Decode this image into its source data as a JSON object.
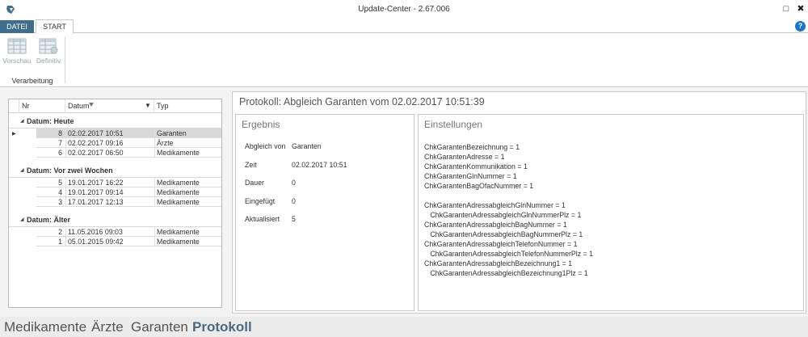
{
  "window": {
    "title": "Update-Center - 2.67.006",
    "maximize_glyph": "□",
    "close_glyph": "✖"
  },
  "ribbon": {
    "tabs": [
      {
        "label": "DATEI"
      },
      {
        "label": "START"
      }
    ],
    "help_glyph": "?",
    "buttons": [
      {
        "label": "Vorschau",
        "icon": "table-preview-icon"
      },
      {
        "label": "Definitiv",
        "icon": "table-final-icon"
      }
    ],
    "group_label": "Verarbeitung"
  },
  "grid": {
    "columns": [
      "Nr",
      "Datum",
      "Typ"
    ],
    "filter_glyph": "▼",
    "groups": [
      {
        "label": "Datum: Heute",
        "rows": [
          {
            "nr": "8",
            "datum": "02.02.2017 10:51",
            "typ": "Garanten",
            "selected": true
          },
          {
            "nr": "7",
            "datum": "02.02.2017 09:16",
            "typ": "Ärzte"
          },
          {
            "nr": "6",
            "datum": "02.02.2017 06:50",
            "typ": "Medikamente"
          }
        ]
      },
      {
        "label": "Datum: Vor zwei Wochen",
        "rows": [
          {
            "nr": "5",
            "datum": "19.01.2017 16:22",
            "typ": "Medikamente"
          },
          {
            "nr": "4",
            "datum": "19.01.2017 09:14",
            "typ": "Medikamente"
          },
          {
            "nr": "3",
            "datum": "17.01.2017 12:13",
            "typ": "Medikamente"
          }
        ]
      },
      {
        "label": "Datum: Älter",
        "rows": [
          {
            "nr": "2",
            "datum": "11.05.2016 09:03",
            "typ": "Medikamente"
          },
          {
            "nr": "1",
            "datum": "05.01.2015 09:42",
            "typ": "Medikamente"
          }
        ]
      }
    ]
  },
  "protocol": {
    "title": "Protokoll: Abgleich Garanten vom 02.02.2017 10:51:39",
    "result": {
      "title": "Ergebnis",
      "items": [
        {
          "key": "Abgleich von",
          "value": "Garanten"
        },
        {
          "key": "Zeit",
          "value": "02.02.2017 10:51"
        },
        {
          "key": "Dauer",
          "value": "0"
        },
        {
          "key": "Eingefügt",
          "value": "0"
        },
        {
          "key": "Aktualisiert",
          "value": "5"
        }
      ]
    },
    "settings": {
      "title": "Einstellungen",
      "lines": [
        "ChkGarantenBezeichnung = 1",
        "ChkGarantenAdresse = 1",
        "ChkGarantenKommunikation = 1",
        "ChkGarantenGlnNummer = 1",
        "ChkGarantenBagOfacNummer = 1",
        "",
        "ChkGarantenAdressabgleichGlnNummer = 1",
        "   ChkGarantenAdressabgleichGlnNummerPlz = 1",
        "ChkGarantenAdressabgleichBagNummer = 1",
        "   ChkGarantenAdressabgleichBagNummerPlz = 1",
        "ChkGarantenAdressabgleichTelefonNummer = 1",
        "   ChkGarantenAdressabgleichTelefonNummerPlz = 1",
        "ChkGarantenAdressabgleichBezeichnung1 = 1",
        "   ChkGarantenAdressabgleichBezeichnung1Plz = 1"
      ]
    }
  },
  "bottom_nav": {
    "items": [
      {
        "label": "Medikamente"
      },
      {
        "label": "Ärzte"
      },
      {
        "label": "Garanten"
      },
      {
        "label": "Protokoll",
        "active": true
      }
    ]
  },
  "colors": {
    "file_tab": "#3f6e8c",
    "active_nav": "#4a6a80",
    "help": "#1e73c8",
    "selected_row": "#d9d9d9"
  }
}
